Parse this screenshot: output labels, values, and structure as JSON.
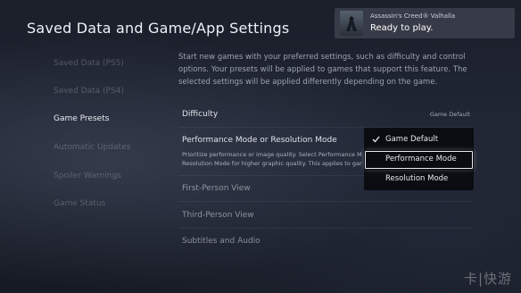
{
  "header": {
    "title": "Saved Data and Game/App Settings"
  },
  "notification": {
    "game": "Assassin's Creed® Valhalla",
    "status": "Ready to play."
  },
  "sidebar": {
    "items": [
      {
        "label": "Saved Data (PS5)"
      },
      {
        "label": "Saved Data (PS4)"
      },
      {
        "label": "Game Presets",
        "active": true
      },
      {
        "label": "Automatic Updates"
      },
      {
        "label": "Spoiler Warnings"
      },
      {
        "label": "Game Status"
      }
    ]
  },
  "main": {
    "description": "Start new games with your preferred settings, such as difficulty and control options. Your presets will be applied to games that support this feature. The selected settings will be applied differently depending on the game.",
    "difficulty": {
      "label": "Difficulty",
      "value": "Game Default"
    },
    "performance": {
      "label": "Performance Mode or Resolution Mode",
      "desc_line1": "Prioritize performance or image quality. Select Performance M",
      "desc_line2": "Resolution Mode for higher graphic quality. This applies to gar"
    },
    "first_person": {
      "label": "First-Person View"
    },
    "third_person": {
      "label": "Third-Person View"
    },
    "subtitles": {
      "label": "Subtitles and Audio"
    }
  },
  "dropdown": {
    "options": [
      {
        "label": "Game Default",
        "selected": true
      },
      {
        "label": "Performance Mode",
        "focused": true
      },
      {
        "label": "Resolution Mode"
      }
    ]
  },
  "watermark": "卡|快游",
  "colors": {
    "background": "#1e2330",
    "dropdown_bg": "#0a0c10",
    "focus_outline": "#e8eaef"
  }
}
